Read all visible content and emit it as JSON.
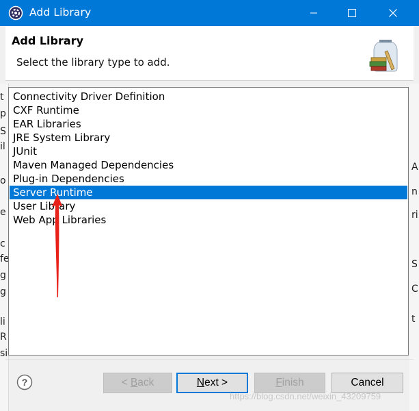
{
  "window": {
    "title": "Add Library"
  },
  "header": {
    "title": "Add Library",
    "description": "Select the library type to add."
  },
  "library_types": [
    {
      "label": "Connectivity Driver Definition",
      "selected": false
    },
    {
      "label": "CXF Runtime",
      "selected": false
    },
    {
      "label": "EAR Libraries",
      "selected": false
    },
    {
      "label": "JRE System Library",
      "selected": false
    },
    {
      "label": "JUnit",
      "selected": false
    },
    {
      "label": "Maven Managed Dependencies",
      "selected": false
    },
    {
      "label": "Plug-in Dependencies",
      "selected": false
    },
    {
      "label": "Server Runtime",
      "selected": true
    },
    {
      "label": "User Library",
      "selected": false
    },
    {
      "label": "Web App Libraries",
      "selected": false
    }
  ],
  "buttons": {
    "back": {
      "prefix": "< ",
      "mnemonic": "B",
      "rest": "ack",
      "enabled": false
    },
    "next": {
      "mnemonic": "N",
      "rest": "ext >",
      "enabled": true
    },
    "finish": {
      "mnemonic": "F",
      "rest": "inish",
      "enabled": false
    },
    "cancel": {
      "label": "Cancel",
      "enabled": true
    }
  },
  "watermark": "https://blog.csdn.net/weixin_43209759",
  "colors": {
    "titlebar": "#0078d7",
    "selection": "#0078d7",
    "annotation_arrow": "#e8221b"
  },
  "icons": [
    "eclipse-gear-icon",
    "minimize-icon",
    "maximize-icon",
    "close-icon",
    "library-jar-icon",
    "help-icon"
  ]
}
